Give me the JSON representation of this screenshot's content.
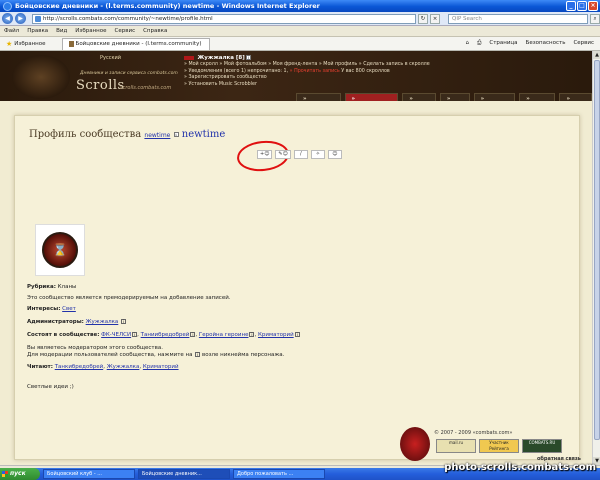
{
  "window": {
    "title": "Бойцовские дневники - (l.terms.community) newtime - Windows Internet Explorer",
    "address": "http://scrolls.combats.com/community/~newtime/profile.html",
    "search_placeholder": "QIP Search"
  },
  "menu": [
    "Файл",
    "Правка",
    "Вид",
    "Избранное",
    "Сервис",
    "Справка"
  ],
  "favbar": {
    "favorites": "Избранное",
    "tab": "Бойцовские дневники - (l.terms.community) newtime",
    "page": "Страница",
    "security": "Безопасность",
    "service": "Сервис"
  },
  "header": {
    "lang": "Русский",
    "slogan": "Дневники и записи сервиса combats.com",
    "logo": "Scrolls",
    "logo_sub": "scrolls.combats.com",
    "user": "Жужжалка [8]",
    "links": [
      "» Мой скролл",
      "» Мой фотоальбом",
      "» Моя френд-лента",
      "» Мой профиль",
      "» Сделать запись в скролле"
    ],
    "notifications": "» Уведомления (всего 1) непрочитано: 1,",
    "notif_hot": "» Прочитать запись",
    "notif_tail": "У вас 800 скроллов",
    "register": "» Зарегистрировать сообщество",
    "install": "» Установить Music Scrobbler"
  },
  "navtabs": [
    "» Скроллы",
    "» Сообщества",
    "» Фото",
    "» FAQ",
    "» Рейтинг",
    "» Поиск",
    "» ЖЗЛ"
  ],
  "profile": {
    "title": "Профиль сообщества",
    "title_small": "newtime",
    "title_name": "newtime",
    "toolbar": [
      "+☺",
      "✎☺",
      "/",
      "✧",
      "☺"
    ],
    "avatar_glyph": "⌛",
    "rubric_label": "Рубрика:",
    "rubric_value": "Кланы",
    "premod": "Это сообщество является премодерируемым на добавление записей.",
    "interests_label": "Интересы:",
    "interests_value": "Свет",
    "admins_label": "Администраторы:",
    "admins_value": "Жужжалка",
    "members_label": "Состоят в сообществе:",
    "members": [
      "ФК-ЧЕЛСИ",
      "Таниибредобрей",
      "Геройна героине",
      "Криматорий"
    ],
    "moderator_line1": "Вы являетесь модератором этого сообщества.",
    "moderator_line2": "Для модерации пользователей сообщества, нажмите на",
    "moderator_line2_tail": "возле никнейма персонажа.",
    "readers_label": "Читают:",
    "readers": [
      "Танкибредобрей",
      "Жужжалка",
      "Криматорий"
    ],
    "motto": "Светлые идеи ;)"
  },
  "footer": {
    "copyright": "© 2007 - 2009 «combats.com»",
    "banners": [
      "mail.ru",
      "Участник Рейтинга",
      "COMBATS.RU"
    ],
    "feedback": "обратная связь"
  },
  "taskbar": {
    "start": "пуск",
    "tasks": [
      "Бойцовский клуб - ...",
      "Бойцовские дневник...",
      "Добро пожаловать ..."
    ]
  },
  "watermark": "photo.scrolls.combats.com"
}
